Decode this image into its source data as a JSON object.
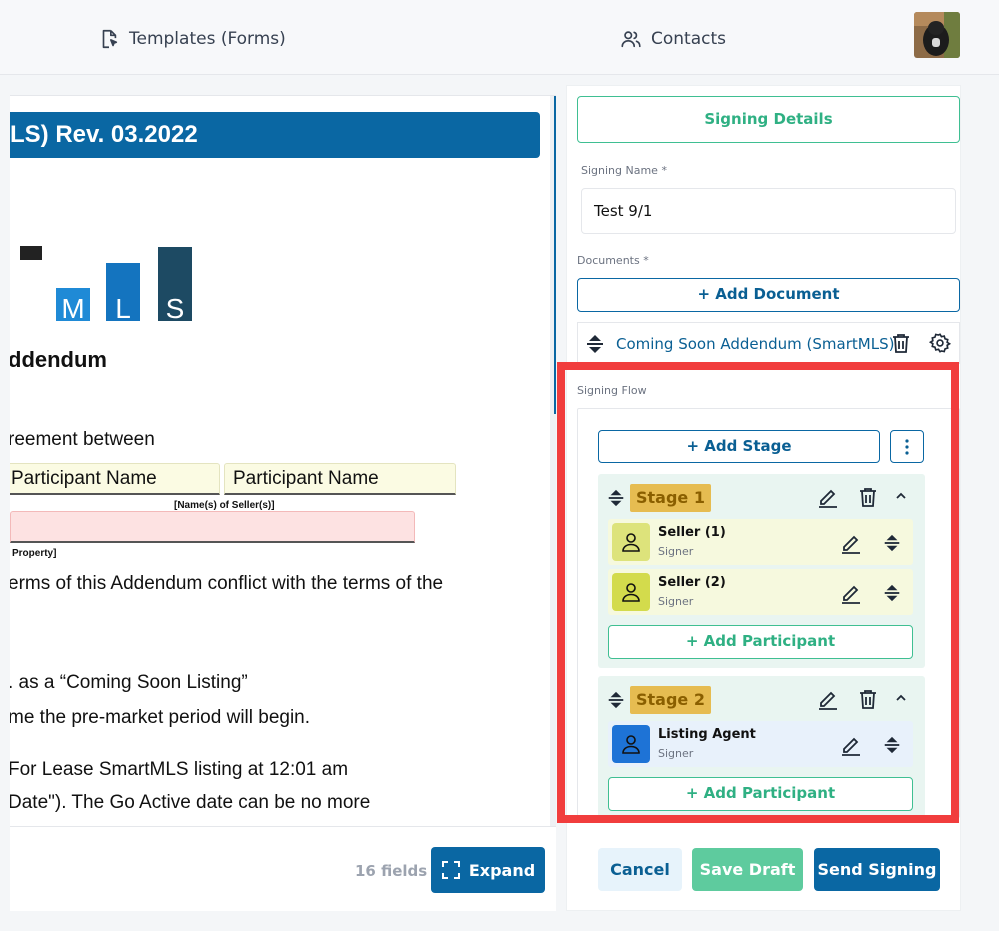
{
  "nav": {
    "templates_label": "Templates (Forms)",
    "contacts_label": "Contacts"
  },
  "document_preview": {
    "banner_text": "LS) Rev. 03.2022",
    "logo_letters": [
      "M",
      "L",
      "S"
    ],
    "heading": "ddendum",
    "line_agreement": "reement between",
    "participant_field_1": "Participant Name",
    "participant_field_2": "Participant Name",
    "seller_caption": "[Name(s) of Seller(s)]",
    "property_caption": "Property]",
    "line_terms": "erms of this Addendum conflict with the terms of the",
    "line_coming_soon": ". as a “Coming Soon Listing”",
    "line_premarket": "me the pre-market period will begin.",
    "line_for_lease": "For Lease SmartMLS listing at 12:01 am",
    "line_go_active": "Date\"). The Go Active date can be no more",
    "fields_count": "16 fields",
    "expand_label": "Expand"
  },
  "panel": {
    "signing_details_label": "Signing Details",
    "signing_name_label": "Signing Name *",
    "signing_name_value": "Test 9/1",
    "documents_label": "Documents *",
    "add_document_label": "+ Add Document",
    "document_name": "Coming Soon Addendum (SmartMLS)",
    "signing_flow_label": "Signing Flow",
    "add_stage_label": "+ Add Stage",
    "stages": [
      {
        "title": "Stage 1",
        "participants": [
          {
            "name": "Seller (1)",
            "role": "Signer"
          },
          {
            "name": "Seller (2)",
            "role": "Signer"
          }
        ],
        "add_participant_label": "+ Add Participant"
      },
      {
        "title": "Stage 2",
        "participants": [
          {
            "name": "Listing Agent",
            "role": "Signer"
          }
        ],
        "add_participant_label": "+ Add Participant"
      }
    ],
    "cancel_label": "Cancel",
    "save_draft_label": "Save Draft",
    "send_signing_label": "Send Signing"
  },
  "colors": {
    "brand_blue": "#0a67a3",
    "accent_green": "#3fbf92",
    "stage_tag": "#e6bc51",
    "highlight_red": "#f13d3d"
  },
  "icons": [
    "document-pointer-icon",
    "users-icon",
    "sort-icon",
    "trash-icon",
    "gear-icon",
    "pencil-icon",
    "chevron-up-icon",
    "user-icon",
    "kebab-icon",
    "expand-icon"
  ]
}
